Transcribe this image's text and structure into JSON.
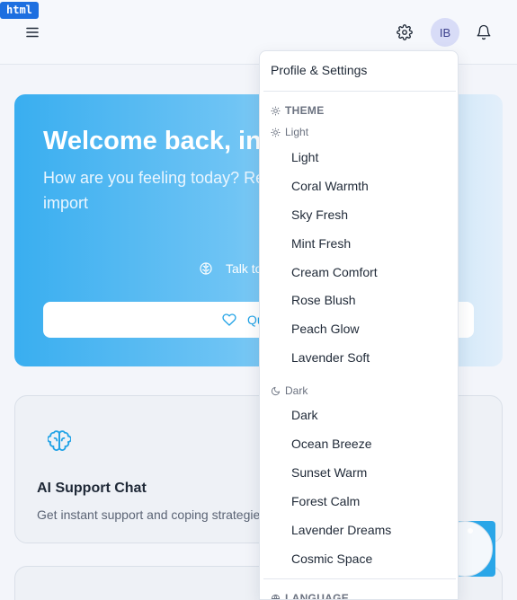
{
  "tag": "html",
  "header": {
    "avatar_initials": "IB",
    "icons": [
      "menu-icon",
      "gear-icon",
      "bell-icon"
    ]
  },
  "hero": {
    "title": "Welcome back, in",
    "subtitle": "How are you feeling today? Re mental health is just as import",
    "talk_label": "Talk to",
    "quick_label": "Quick W"
  },
  "card": {
    "title": "AI Support Chat",
    "description": "Get instant support and coping strategie"
  },
  "dropdown": {
    "header": "Profile & Settings",
    "theme_label": "THEME",
    "light_label": "Light",
    "light_items": [
      "Light",
      "Coral Warmth",
      "Sky Fresh",
      "Mint Fresh",
      "Cream Comfort",
      "Rose Blush",
      "Peach Glow",
      "Lavender Soft"
    ],
    "dark_label": "Dark",
    "dark_items": [
      "Dark",
      "Ocean Breeze",
      "Sunset Warm",
      "Forest Calm",
      "Lavender Dreams",
      "Cosmic Space"
    ],
    "language_label": "LANGUAGE"
  },
  "colors": {
    "accent": "#22a3e6",
    "hero_start": "#39aef0",
    "avatar_bg": "#d8dcf7"
  }
}
